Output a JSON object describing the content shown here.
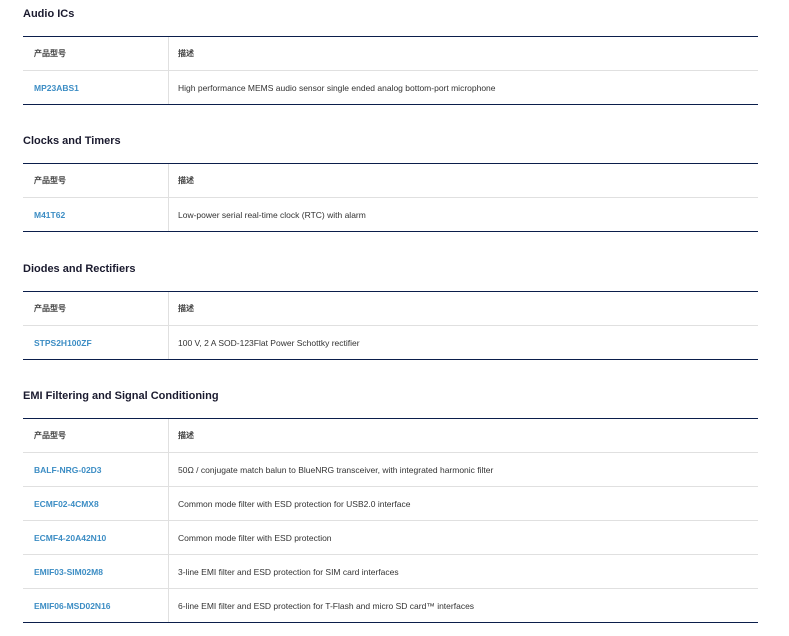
{
  "sections": [
    {
      "title": "Audio ICs",
      "header": {
        "part": "产品型号",
        "desc": "描述"
      },
      "rows": [
        {
          "part": "MP23ABS1",
          "desc": "High performance MEMS audio sensor single ended analog bottom-port microphone"
        }
      ]
    },
    {
      "title": "Clocks and Timers",
      "header": {
        "part": "产品型号",
        "desc": "描述"
      },
      "rows": [
        {
          "part": "M41T62",
          "desc": "Low-power serial real-time clock (RTC) with alarm"
        }
      ]
    },
    {
      "title": "Diodes and Rectifiers",
      "header": {
        "part": "产品型号",
        "desc": "描述"
      },
      "rows": [
        {
          "part": "STPS2H100ZF",
          "desc": "100 V, 2 A SOD-123Flat Power Schottky rectifier"
        }
      ]
    },
    {
      "title": "EMI Filtering and Signal Conditioning",
      "header": {
        "part": "产品型号",
        "desc": "描述"
      },
      "rows": [
        {
          "part": "BALF-NRG-02D3",
          "desc": "50Ω / conjugate match balun to BlueNRG transceiver, with integrated harmonic filter"
        },
        {
          "part": "ECMF02-4CMX8",
          "desc": "Common mode filter with ESD protection for USB2.0 interface"
        },
        {
          "part": "ECMF4-20A42N10",
          "desc": "Common mode filter with ESD protection"
        },
        {
          "part": "EMIF03-SIM02M8",
          "desc": "3-line EMI filter and ESD protection for SIM card interfaces"
        },
        {
          "part": "EMIF06-MSD02N16",
          "desc": "6-line EMI filter and ESD protection for T-Flash and micro SD card™ interfaces"
        }
      ]
    }
  ],
  "colors": {
    "link": "#3c8dc4",
    "rule": "#0b1e4b"
  }
}
